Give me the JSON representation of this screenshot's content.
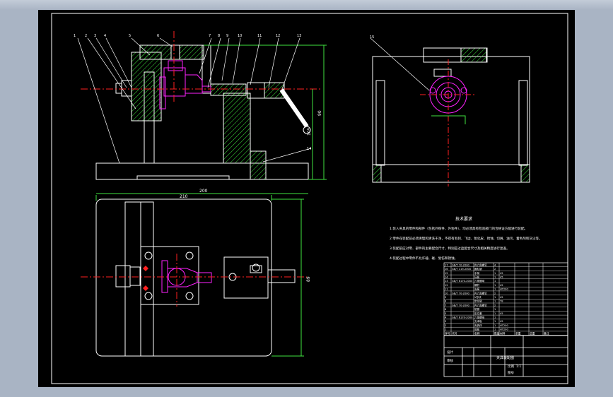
{
  "drawing": {
    "balloons": [
      "1",
      "2",
      "3",
      "4",
      "5",
      "6",
      "7",
      "8",
      "9",
      "10",
      "11",
      "12",
      "13",
      "14",
      "15",
      "16",
      "17"
    ],
    "dims": {
      "height_a": "90",
      "height_b": "105",
      "width_top": "200",
      "height_right": "89",
      "width_bottom": "210"
    },
    "notes_title": "技术要求",
    "notes": [
      "1.装入夹具的零件和部件（包括外购件、外协件），均必须具有检验部门的合格证方能进行装配。",
      "2.零件在装配前必须清理和清洗干净，不得有毛刺、飞边、氧化皮、锈蚀、切屑、油污、着色剂和灰尘等。",
      "3.装配前应对零、部件的主要配合尺寸，特别是过盈配合尺寸及相关精度进行复查。",
      "4.装配过程中零件不允许磕、碰、划伤和锈蚀。"
    ],
    "bom_rows": [
      [
        "17",
        "GB/T 70-2000",
        "内六角螺钉",
        "4",
        "",
        "",
        "",
        ""
      ],
      [
        "16",
        "GB/T 119-2000",
        "圆柱销",
        "2",
        "",
        "",
        "",
        ""
      ],
      [
        "15",
        "",
        "手柄",
        "1",
        "45",
        "",
        "",
        ""
      ],
      [
        "14",
        "",
        "压板",
        "1",
        "45",
        "",
        "",
        ""
      ],
      [
        "13",
        "GB/T 6170-2000",
        "六角螺母",
        "1",
        "",
        "",
        "",
        ""
      ],
      [
        "12",
        "",
        "螺杆",
        "1",
        "45",
        "",
        "",
        ""
      ],
      [
        "11",
        "",
        "支座",
        "1",
        "HT200",
        "",
        "",
        ""
      ],
      [
        "10",
        "GB/T 70-2000",
        "内六角螺钉",
        "2",
        "",
        "",
        "",
        ""
      ],
      [
        "9",
        "",
        "V形块",
        "1",
        "45",
        "",
        "",
        ""
      ],
      [
        "8",
        "",
        "定位销",
        "1",
        "T8",
        "",
        "",
        ""
      ],
      [
        "7",
        "GB/T 70-2000",
        "内六角螺钉",
        "2",
        "",
        "",
        "",
        ""
      ],
      [
        "6",
        "",
        "垫圈",
        "1",
        "",
        "",
        "",
        ""
      ],
      [
        "5",
        "",
        "定位套",
        "1",
        "45",
        "",
        "",
        ""
      ],
      [
        "4",
        "GB/T 6170-2000",
        "六角螺母",
        "1",
        "",
        "",
        "",
        ""
      ],
      [
        "3",
        "",
        "支承板",
        "1",
        "45",
        "",
        "",
        ""
      ],
      [
        "2",
        "",
        "夹具体",
        "1",
        "HT200",
        "",
        "",
        ""
      ],
      [
        "1",
        "",
        "底板",
        "1",
        "HT200",
        "",
        "",
        ""
      ]
    ],
    "bom_header": [
      "序号",
      "代号",
      "名称",
      "数量",
      "材料",
      "单重",
      "总重",
      "备注"
    ],
    "title_block": [
      "夹具装配图",
      "比例",
      "1:1",
      "图号",
      "",
      "设计",
      "",
      "审核",
      ""
    ]
  }
}
